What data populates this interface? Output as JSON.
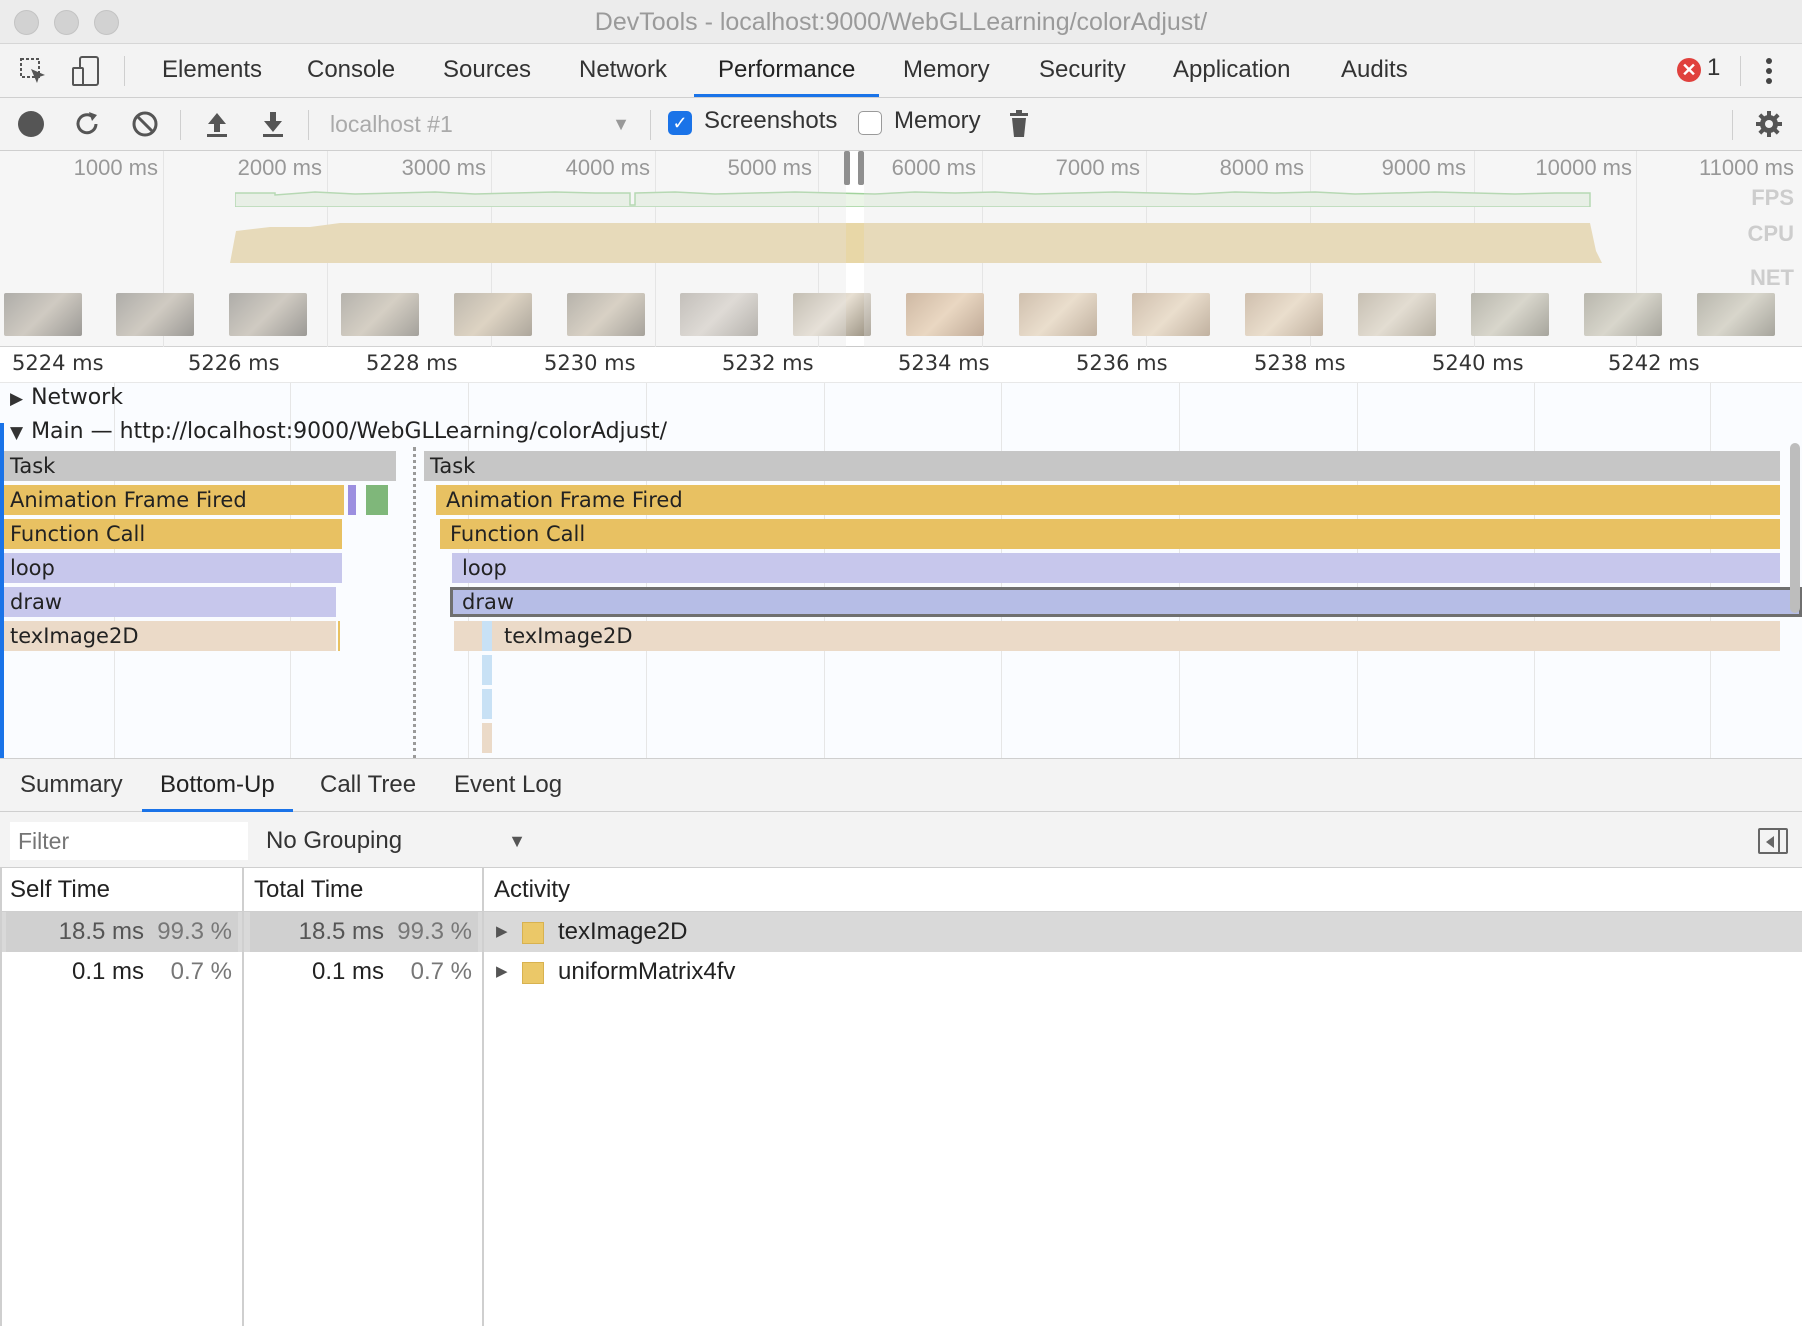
{
  "window": {
    "title": "DevTools - localhost:9000/WebGLLearning/colorAdjust/"
  },
  "main_tabs": [
    "Elements",
    "Console",
    "Sources",
    "Network",
    "Performance",
    "Memory",
    "Security",
    "Application",
    "Audits"
  ],
  "active_main_tab": "Performance",
  "error_count": "1",
  "toolbar": {
    "target": "localhost #1",
    "screenshots_label": "Screenshots",
    "screenshots_checked": true,
    "memory_label": "Memory",
    "memory_checked": false
  },
  "overview": {
    "ticks": [
      "1000 ms",
      "2000 ms",
      "3000 ms",
      "4000 ms",
      "5000 ms",
      "6000 ms",
      "7000 ms",
      "8000 ms",
      "9000 ms",
      "10000 ms",
      "11000 ms"
    ],
    "lanes": [
      "FPS",
      "CPU",
      "NET"
    ]
  },
  "flame": {
    "ticks": [
      "5224 ms",
      "5226 ms",
      "5228 ms",
      "5230 ms",
      "5232 ms",
      "5234 ms",
      "5236 ms",
      "5238 ms",
      "5240 ms",
      "5242 ms"
    ],
    "network_track": "Network",
    "main_track": "Main — http://localhost:9000/WebGLLearning/colorAdjust/",
    "left_stack": [
      "Task",
      "Animation Frame Fired",
      "Function Call",
      "loop",
      "draw",
      "texImage2D"
    ],
    "right_stack": [
      "Task",
      "Animation Frame Fired",
      "Function Call",
      "loop",
      "draw",
      "texImage2D"
    ]
  },
  "bottom_tabs": [
    "Summary",
    "Bottom-Up",
    "Call Tree",
    "Event Log"
  ],
  "active_bottom_tab": "Bottom-Up",
  "filter": {
    "placeholder": "Filter",
    "grouping": "No Grouping"
  },
  "table": {
    "headers": {
      "self": "Self Time",
      "total": "Total Time",
      "activity": "Activity"
    },
    "rows": [
      {
        "self_ms": "18.5 ms",
        "self_pct": "99.3 %",
        "total_ms": "18.5 ms",
        "total_pct": "99.3 %",
        "activity": "texImage2D"
      },
      {
        "self_ms": "0.1 ms",
        "self_pct": "0.7 %",
        "total_ms": "0.1 ms",
        "total_pct": "0.7 %",
        "activity": "uniformMatrix4fv"
      }
    ]
  },
  "colors": {
    "accent": "#1a73e8",
    "scripting": "#e8c162",
    "loop": "#c7c7ec",
    "painting": "#ebdac8",
    "task": "#c6c6c6"
  }
}
